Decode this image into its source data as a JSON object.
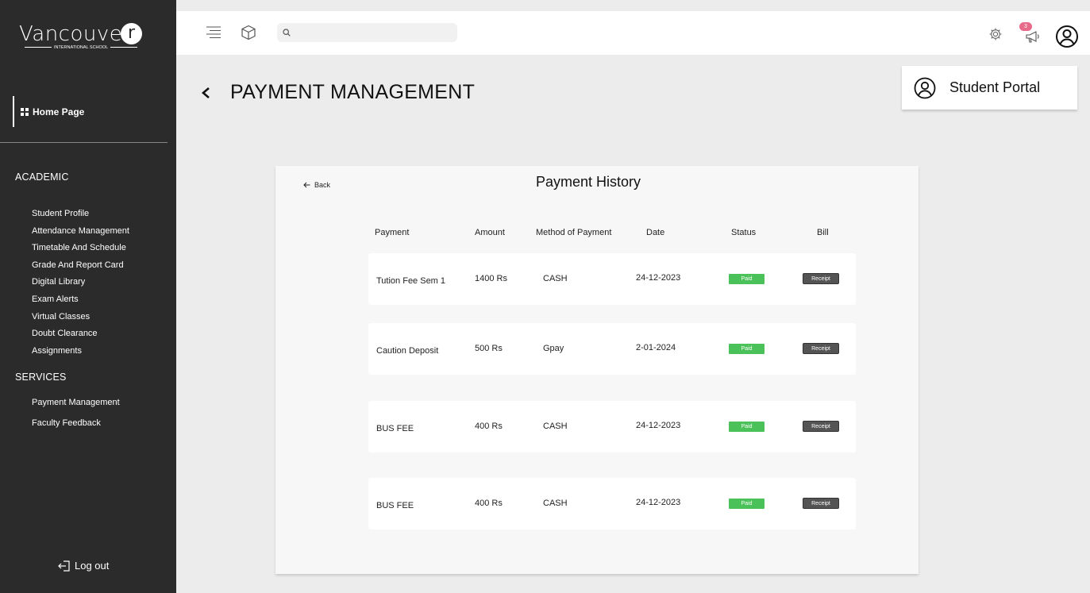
{
  "logo": {
    "word": "Vancouve",
    "letter": "r",
    "subtitle": "INTERNATIONAL SCHOOL"
  },
  "sidebar": {
    "home_label": "Home Page",
    "academic_title": "ACADEMIC",
    "academic_items": [
      "Student Profile",
      "Attendance Management",
      "Timetable And Schedule",
      "Grade And Report Card",
      "Digital Library",
      "Exam Alerts",
      "Virtual Classes",
      "Doubt Clearance",
      "Assignments"
    ],
    "services_title": "SERVICES",
    "services_items": [
      "Payment Management",
      "Faculty Feedback"
    ],
    "logout_label": "Log out"
  },
  "topbar": {
    "search_placeholder": "",
    "notification_count": "3"
  },
  "page": {
    "title": "PAYMENT MANAGEMENT",
    "portal_label": "Student Portal"
  },
  "panel": {
    "back_label": "Back",
    "title": "Payment History",
    "headers": [
      "Payment",
      "Amount",
      "Method of Payment",
      "Date",
      "Status",
      "Bill"
    ],
    "rows": [
      {
        "payment": "Tution Fee Sem 1",
        "amount": "1400  Rs",
        "method": "CASH",
        "date": "24-12-2023",
        "status": "Paid",
        "bill": "Receipt"
      },
      {
        "payment": "Caution Deposit",
        "amount": "500  Rs",
        "method": "Gpay",
        "date": "2-01-2024",
        "status": "Paid",
        "bill": "Receipt"
      },
      {
        "payment": "BUS FEE",
        "amount": "400  Rs",
        "method": "CASH",
        "date": "24-12-2023",
        "status": "Paid",
        "bill": "Receipt"
      },
      {
        "payment": "BUS FEE",
        "amount": "400  Rs",
        "method": "CASH",
        "date": "24-12-2023",
        "status": "Paid",
        "bill": "Receipt"
      }
    ]
  },
  "colors": {
    "sidebar_bg": "#2b2b2b",
    "paid_green": "#4bc159",
    "receipt_gray": "#545454",
    "badge_pink": "#e86a8a"
  }
}
